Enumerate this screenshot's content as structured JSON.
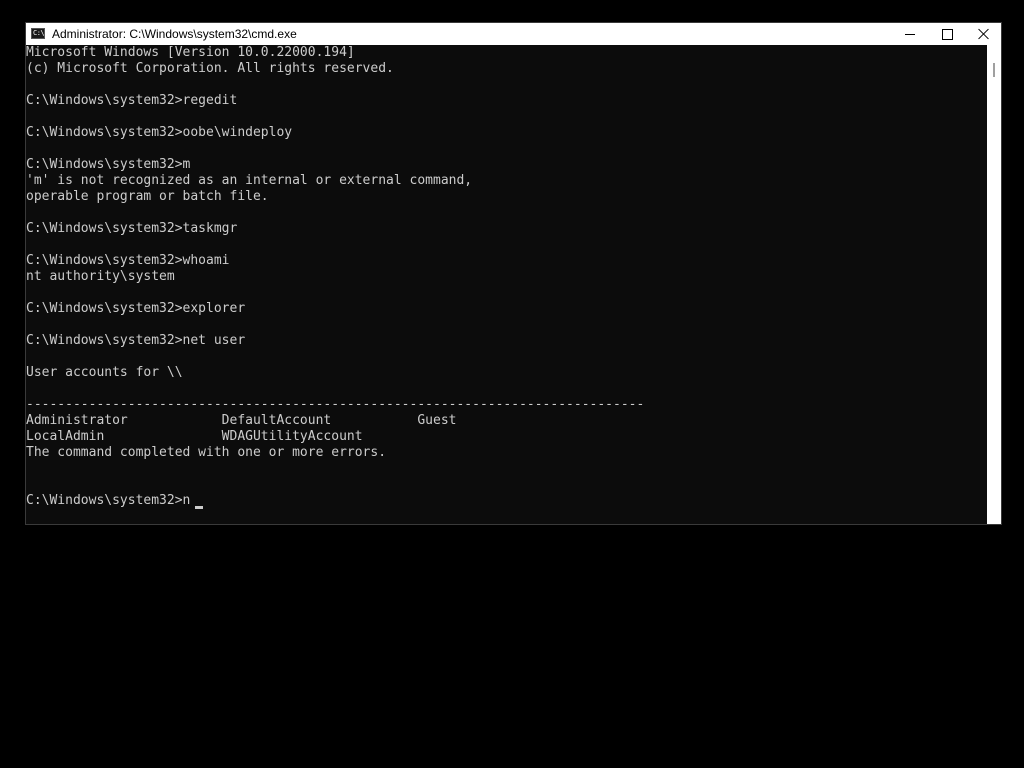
{
  "window": {
    "title": "Administrator: C:\\Windows\\system32\\cmd.exe",
    "icon": "cmd-icon",
    "icon_glyph": "C:\\",
    "buttons": {
      "minimize": "minimize-icon",
      "maximize": "maximize-icon",
      "close": "close-icon"
    }
  },
  "console": {
    "lines": [
      "Microsoft Windows [Version 10.0.22000.194]",
      "(c) Microsoft Corporation. All rights reserved.",
      "",
      "C:\\Windows\\system32>regedit",
      "",
      "C:\\Windows\\system32>oobe\\windeploy",
      "",
      "C:\\Windows\\system32>m",
      "'m' is not recognized as an internal or external command,",
      "operable program or batch file.",
      "",
      "C:\\Windows\\system32>taskmgr",
      "",
      "C:\\Windows\\system32>whoami",
      "nt authority\\system",
      "",
      "C:\\Windows\\system32>explorer",
      "",
      "C:\\Windows\\system32>net user",
      "",
      "User accounts for \\\\",
      "",
      "-------------------------------------------------------------------------------",
      "Administrator            DefaultAccount           Guest",
      "LocalAdmin               WDAGUtilityAccount",
      "The command completed with one or more errors.",
      "",
      "",
      "C:\\Windows\\system32>n"
    ]
  },
  "colors": {
    "console_background": "#0c0c0c",
    "console_foreground": "#cccccc",
    "titlebar_background": "#ffffff"
  }
}
